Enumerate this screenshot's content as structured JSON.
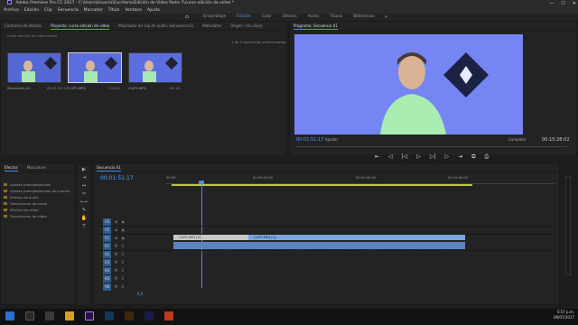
{
  "titlebar": {
    "title": "Adobe Premiere Pro CC 2017 - C:\\Users\\Usuario\\Escritorio\\Edición de Video Parte 7\\curso edición de video *",
    "minimize": "—",
    "maximize": "☐",
    "close": "✕"
  },
  "menu": [
    "Archivo",
    "Edición",
    "Clip",
    "Secuencia",
    "Marcador",
    "Título",
    "Ventana",
    "Ayuda"
  ],
  "workspaces": {
    "home": "⌂",
    "items": [
      "Ensamblaje",
      "Edición",
      "Color",
      "Efectos",
      "Audio",
      "Títulos",
      "Bibliotecas"
    ],
    "active": "Edición",
    "more": "»"
  },
  "project": {
    "tabs": [
      "Controles de efectos",
      "Proyecto: curso edición de video",
      "Mezclador de clip de audio: Secuencia 01",
      "Metadatos",
      "Origen: (sin clips)"
    ],
    "active_tab": "Proyecto: curso edición de video",
    "search": "curso edición de video.prproj",
    "count": "1 de 3 elementos seleccionados",
    "clips": [
      {
        "name": "Secuencia 01",
        "time": "00:01:51:17"
      },
      {
        "name": "CLIP2.MP4",
        "time": "03:04"
      },
      {
        "name": "CLIP3.MP4",
        "time": "00:18"
      }
    ]
  },
  "program": {
    "title": "Programa: Secuencia 01",
    "timecode": "00:01:51:17",
    "fit": "Ajustar",
    "resolution": "Completo",
    "duration": "00:15:28:02",
    "transport": [
      "⇤",
      "◁",
      "|◁",
      "▷",
      "▷|",
      "▷",
      "⇥",
      "⧉",
      "⎙"
    ]
  },
  "effects": {
    "tabs": [
      "Efectos",
      "Marcadore"
    ],
    "items": [
      "Ajustes preestablecidos",
      "Ajustes preestablecidos de Lumetri",
      "Efectos de audio",
      "Transiciones de audio",
      "Efectos de vídeo",
      "Transiciones de vídeo"
    ]
  },
  "timeline": {
    "tab": "Secuencia 01",
    "timecode": "00:01:51:17",
    "ruler": [
      "00:00",
      "00:05:00:00",
      "00:10:00:00",
      "00:15:00:00"
    ],
    "tracks": [
      "V3",
      "V2",
      "V1",
      "A1",
      "A2",
      "A3",
      "A4",
      "A5",
      "A6"
    ],
    "clip_v1_a": "CLIP2.MP4 [V]",
    "clip_v1_b": "CLIP3.MP4 [V]",
    "master": "0,0"
  },
  "tools": [
    "▶",
    "⇥",
    "↔",
    "✂",
    "⟷",
    "✎",
    "✋",
    "T"
  ],
  "clock": {
    "time": "5:57 p.m.",
    "date": "06/07/2017"
  },
  "colors": {
    "accent": "#4a8cff",
    "workarea": "#bfc64a",
    "video_bg": "#6e7ff0",
    "clip_v": "#7aa6e0",
    "clip_a": "#5a84c0"
  }
}
